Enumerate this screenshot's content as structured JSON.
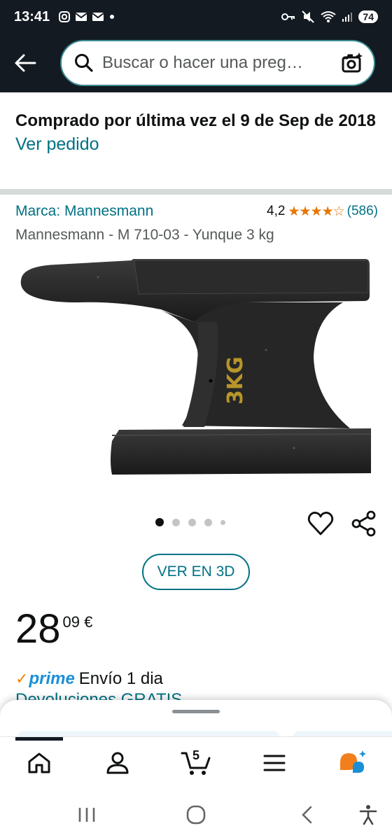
{
  "status_bar": {
    "time": "13:41",
    "battery": "74"
  },
  "search": {
    "placeholder": "Buscar o hacer una preg…"
  },
  "last_purchase": {
    "text": "Comprado por última vez el 9 de Sep de 2018",
    "view_order": "Ver pedido"
  },
  "product": {
    "brand": "Marca: Mannesmann",
    "rating": "4,2",
    "stars": 4.2,
    "review_count": "(586)",
    "title": "Mannesmann - M 710-03 - Yunque 3 kg",
    "image_label": "3KG",
    "image_count": 5,
    "active_image": 1,
    "view_3d": "VER EN 3D",
    "price_whole": "28",
    "price_fraction": "09 €",
    "prime": "prime",
    "shipping": "Envío 1 dia",
    "returns": "Devoluciones GRATIS"
  },
  "nav": {
    "cart_count": "5",
    "items": [
      "home-icon",
      "account-icon",
      "cart-icon",
      "menu-icon",
      "rufus-icon"
    ]
  },
  "colors": {
    "header_bg": "#131a22",
    "link": "#007185",
    "star": "#e77600",
    "prime": "#1a8fd6"
  }
}
